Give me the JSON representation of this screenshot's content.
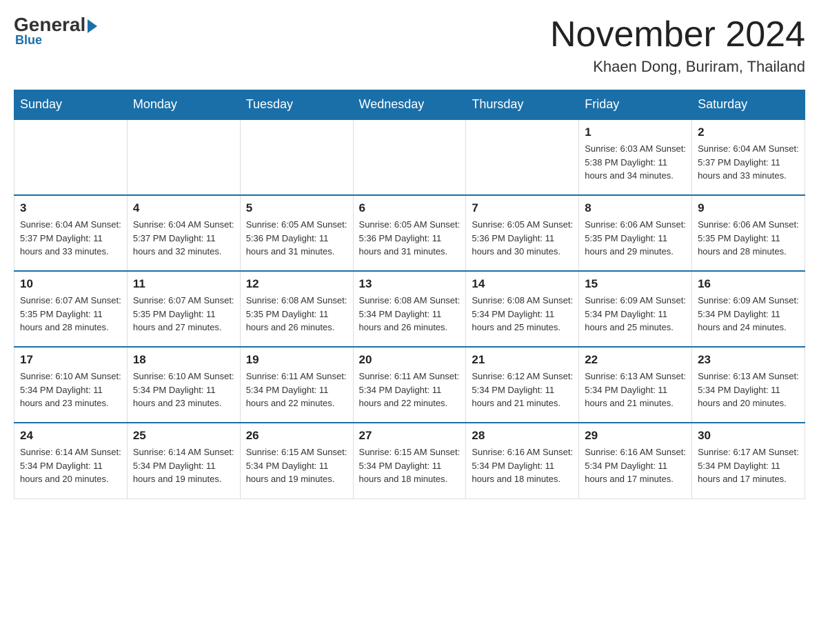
{
  "header": {
    "logo": {
      "general": "General",
      "blue": "Blue",
      "sub": "Blue"
    },
    "title": "November 2024",
    "location": "Khaen Dong, Buriram, Thailand"
  },
  "days_of_week": [
    "Sunday",
    "Monday",
    "Tuesday",
    "Wednesday",
    "Thursday",
    "Friday",
    "Saturday"
  ],
  "weeks": [
    [
      {
        "day": "",
        "info": ""
      },
      {
        "day": "",
        "info": ""
      },
      {
        "day": "",
        "info": ""
      },
      {
        "day": "",
        "info": ""
      },
      {
        "day": "",
        "info": ""
      },
      {
        "day": "1",
        "info": "Sunrise: 6:03 AM\nSunset: 5:38 PM\nDaylight: 11 hours\nand 34 minutes."
      },
      {
        "day": "2",
        "info": "Sunrise: 6:04 AM\nSunset: 5:37 PM\nDaylight: 11 hours\nand 33 minutes."
      }
    ],
    [
      {
        "day": "3",
        "info": "Sunrise: 6:04 AM\nSunset: 5:37 PM\nDaylight: 11 hours\nand 33 minutes."
      },
      {
        "day": "4",
        "info": "Sunrise: 6:04 AM\nSunset: 5:37 PM\nDaylight: 11 hours\nand 32 minutes."
      },
      {
        "day": "5",
        "info": "Sunrise: 6:05 AM\nSunset: 5:36 PM\nDaylight: 11 hours\nand 31 minutes."
      },
      {
        "day": "6",
        "info": "Sunrise: 6:05 AM\nSunset: 5:36 PM\nDaylight: 11 hours\nand 31 minutes."
      },
      {
        "day": "7",
        "info": "Sunrise: 6:05 AM\nSunset: 5:36 PM\nDaylight: 11 hours\nand 30 minutes."
      },
      {
        "day": "8",
        "info": "Sunrise: 6:06 AM\nSunset: 5:35 PM\nDaylight: 11 hours\nand 29 minutes."
      },
      {
        "day": "9",
        "info": "Sunrise: 6:06 AM\nSunset: 5:35 PM\nDaylight: 11 hours\nand 28 minutes."
      }
    ],
    [
      {
        "day": "10",
        "info": "Sunrise: 6:07 AM\nSunset: 5:35 PM\nDaylight: 11 hours\nand 28 minutes."
      },
      {
        "day": "11",
        "info": "Sunrise: 6:07 AM\nSunset: 5:35 PM\nDaylight: 11 hours\nand 27 minutes."
      },
      {
        "day": "12",
        "info": "Sunrise: 6:08 AM\nSunset: 5:35 PM\nDaylight: 11 hours\nand 26 minutes."
      },
      {
        "day": "13",
        "info": "Sunrise: 6:08 AM\nSunset: 5:34 PM\nDaylight: 11 hours\nand 26 minutes."
      },
      {
        "day": "14",
        "info": "Sunrise: 6:08 AM\nSunset: 5:34 PM\nDaylight: 11 hours\nand 25 minutes."
      },
      {
        "day": "15",
        "info": "Sunrise: 6:09 AM\nSunset: 5:34 PM\nDaylight: 11 hours\nand 25 minutes."
      },
      {
        "day": "16",
        "info": "Sunrise: 6:09 AM\nSunset: 5:34 PM\nDaylight: 11 hours\nand 24 minutes."
      }
    ],
    [
      {
        "day": "17",
        "info": "Sunrise: 6:10 AM\nSunset: 5:34 PM\nDaylight: 11 hours\nand 23 minutes."
      },
      {
        "day": "18",
        "info": "Sunrise: 6:10 AM\nSunset: 5:34 PM\nDaylight: 11 hours\nand 23 minutes."
      },
      {
        "day": "19",
        "info": "Sunrise: 6:11 AM\nSunset: 5:34 PM\nDaylight: 11 hours\nand 22 minutes."
      },
      {
        "day": "20",
        "info": "Sunrise: 6:11 AM\nSunset: 5:34 PM\nDaylight: 11 hours\nand 22 minutes."
      },
      {
        "day": "21",
        "info": "Sunrise: 6:12 AM\nSunset: 5:34 PM\nDaylight: 11 hours\nand 21 minutes."
      },
      {
        "day": "22",
        "info": "Sunrise: 6:13 AM\nSunset: 5:34 PM\nDaylight: 11 hours\nand 21 minutes."
      },
      {
        "day": "23",
        "info": "Sunrise: 6:13 AM\nSunset: 5:34 PM\nDaylight: 11 hours\nand 20 minutes."
      }
    ],
    [
      {
        "day": "24",
        "info": "Sunrise: 6:14 AM\nSunset: 5:34 PM\nDaylight: 11 hours\nand 20 minutes."
      },
      {
        "day": "25",
        "info": "Sunrise: 6:14 AM\nSunset: 5:34 PM\nDaylight: 11 hours\nand 19 minutes."
      },
      {
        "day": "26",
        "info": "Sunrise: 6:15 AM\nSunset: 5:34 PM\nDaylight: 11 hours\nand 19 minutes."
      },
      {
        "day": "27",
        "info": "Sunrise: 6:15 AM\nSunset: 5:34 PM\nDaylight: 11 hours\nand 18 minutes."
      },
      {
        "day": "28",
        "info": "Sunrise: 6:16 AM\nSunset: 5:34 PM\nDaylight: 11 hours\nand 18 minutes."
      },
      {
        "day": "29",
        "info": "Sunrise: 6:16 AM\nSunset: 5:34 PM\nDaylight: 11 hours\nand 17 minutes."
      },
      {
        "day": "30",
        "info": "Sunrise: 6:17 AM\nSunset: 5:34 PM\nDaylight: 11 hours\nand 17 minutes."
      }
    ]
  ]
}
